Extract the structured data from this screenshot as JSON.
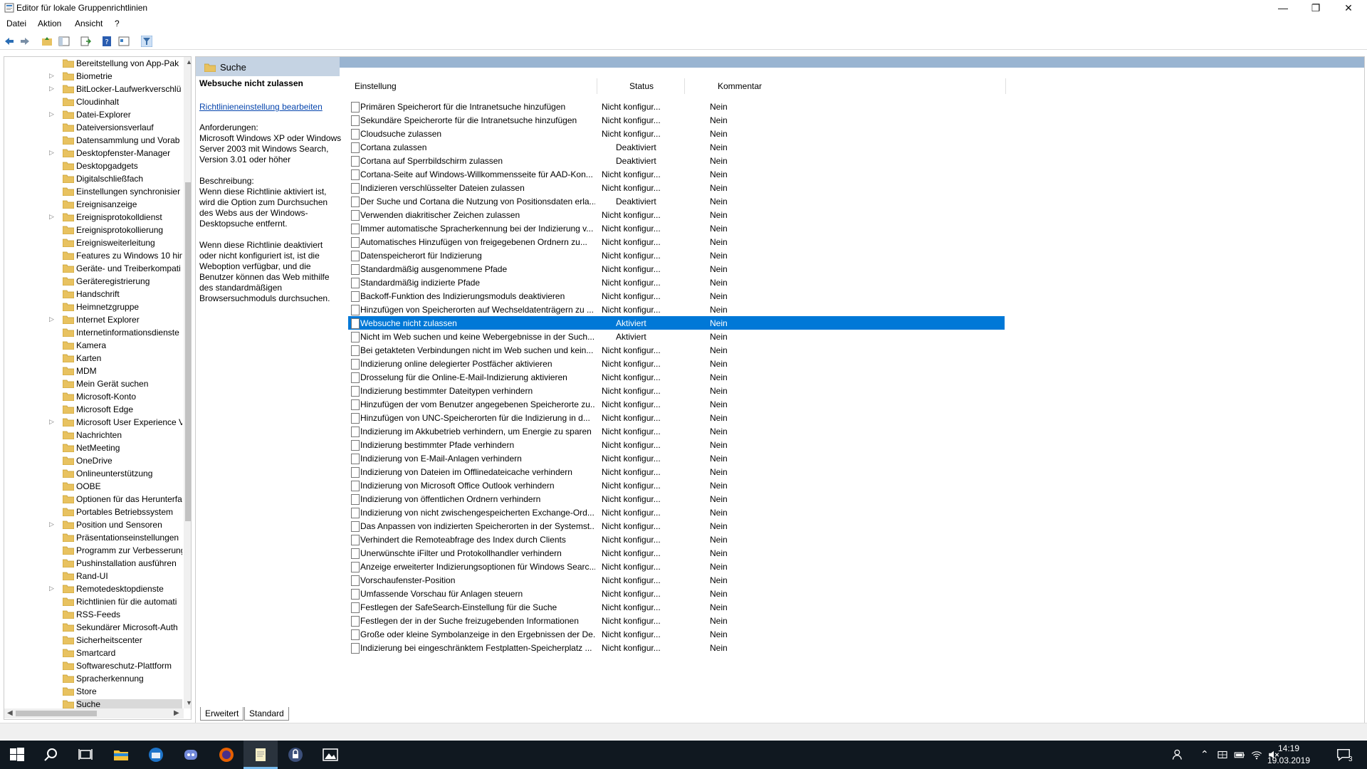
{
  "window": {
    "title": "Editor für lokale Gruppenrichtlinien"
  },
  "menu": [
    "Datei",
    "Aktion",
    "Ansicht",
    "?"
  ],
  "tree": {
    "items": [
      {
        "label": "Bereitstellung von App-Pak",
        "expandable": false
      },
      {
        "label": "Biometrie",
        "expandable": true
      },
      {
        "label": "BitLocker-Laufwerkverschlü",
        "expandable": true
      },
      {
        "label": "Cloudinhalt",
        "expandable": false
      },
      {
        "label": "Datei-Explorer",
        "expandable": true
      },
      {
        "label": "Dateiversionsverlauf",
        "expandable": false
      },
      {
        "label": "Datensammlung und Vorab",
        "expandable": false
      },
      {
        "label": "Desktopfenster-Manager",
        "expandable": true
      },
      {
        "label": "Desktopgadgets",
        "expandable": false
      },
      {
        "label": "Digitalschließfach",
        "expandable": false
      },
      {
        "label": "Einstellungen synchronisier",
        "expandable": false
      },
      {
        "label": "Ereignisanzeige",
        "expandable": false
      },
      {
        "label": "Ereignisprotokolldienst",
        "expandable": true
      },
      {
        "label": "Ereignisprotokollierung",
        "expandable": false
      },
      {
        "label": "Ereignisweiterleitung",
        "expandable": false
      },
      {
        "label": "Features zu Windows 10 hin",
        "expandable": false
      },
      {
        "label": "Geräte- und Treiberkompati",
        "expandable": false
      },
      {
        "label": "Geräteregistrierung",
        "expandable": false
      },
      {
        "label": "Handschrift",
        "expandable": false
      },
      {
        "label": "Heimnetzgruppe",
        "expandable": false
      },
      {
        "label": "Internet Explorer",
        "expandable": true
      },
      {
        "label": "Internetinformationsdienste",
        "expandable": false
      },
      {
        "label": "Kamera",
        "expandable": false
      },
      {
        "label": "Karten",
        "expandable": false
      },
      {
        "label": "MDM",
        "expandable": false
      },
      {
        "label": "Mein Gerät suchen",
        "expandable": false
      },
      {
        "label": "Microsoft-Konto",
        "expandable": false
      },
      {
        "label": "Microsoft Edge",
        "expandable": false
      },
      {
        "label": "Microsoft User Experience V",
        "expandable": true
      },
      {
        "label": "Nachrichten",
        "expandable": false
      },
      {
        "label": "NetMeeting",
        "expandable": false
      },
      {
        "label": "OneDrive",
        "expandable": false
      },
      {
        "label": "Onlineunterstützung",
        "expandable": false
      },
      {
        "label": "OOBE",
        "expandable": false
      },
      {
        "label": "Optionen für das Herunterfa",
        "expandable": false
      },
      {
        "label": "Portables Betriebssystem",
        "expandable": false
      },
      {
        "label": "Position und Sensoren",
        "expandable": true
      },
      {
        "label": "Präsentationseinstellungen",
        "expandable": false
      },
      {
        "label": "Programm zur Verbesserung",
        "expandable": false
      },
      {
        "label": "Pushinstallation ausführen",
        "expandable": false
      },
      {
        "label": "Rand-UI",
        "expandable": false
      },
      {
        "label": "Remotedesktopdienste",
        "expandable": true
      },
      {
        "label": "Richtlinien für die automati",
        "expandable": false
      },
      {
        "label": "RSS-Feeds",
        "expandable": false
      },
      {
        "label": "Sekundärer Microsoft-Auth",
        "expandable": false
      },
      {
        "label": "Sicherheitscenter",
        "expandable": false
      },
      {
        "label": "Smartcard",
        "expandable": false
      },
      {
        "label": "Softwareschutz-Plattform",
        "expandable": false
      },
      {
        "label": "Spracherkennung",
        "expandable": false
      },
      {
        "label": "Store",
        "expandable": false
      },
      {
        "label": "Suche",
        "expandable": false,
        "selected": true
      }
    ]
  },
  "main": {
    "title": "Suche",
    "description": {
      "title": "Websuche nicht zulassen",
      "link": "Richtlinieneinstellung bearbeiten",
      "requirements_label": "Anforderungen:",
      "requirements_text": "Microsoft Windows XP oder Windows Server 2003 mit Windows Search, Version 3.01 oder höher",
      "description_label": "Beschreibung:",
      "description_p1": "Wenn diese Richtlinie aktiviert ist, wird die Option zum Durchsuchen des Webs aus der Windows-Desktopsuche entfernt.",
      "description_p2": "Wenn diese Richtlinie deaktiviert oder nicht konfiguriert ist, ist die Weboption verfügbar, und die Benutzer können das Web mithilfe des standardmäßigen Browsersuchmoduls durchsuchen."
    },
    "columns": {
      "setting": "Einstellung",
      "status": "Status",
      "comment": "Kommentar"
    },
    "rows": [
      {
        "name": "Primären Speicherort für die Intranetsuche hinzufügen",
        "status": "Nicht konfigur...",
        "comment": "Nein"
      },
      {
        "name": "Sekundäre Speicherorte für die Intranetsuche hinzufügen",
        "status": "Nicht konfigur...",
        "comment": "Nein"
      },
      {
        "name": "Cloudsuche zulassen",
        "status": "Nicht konfigur...",
        "comment": "Nein"
      },
      {
        "name": "Cortana zulassen",
        "status": "Deaktiviert",
        "comment": "Nein"
      },
      {
        "name": "Cortana auf Sperrbildschirm zulassen",
        "status": "Deaktiviert",
        "comment": "Nein"
      },
      {
        "name": "Cortana-Seite auf Windows-Willkommensseite für AAD-Kon...",
        "status": "Nicht konfigur...",
        "comment": "Nein"
      },
      {
        "name": "Indizieren verschlüsselter Dateien zulassen",
        "status": "Nicht konfigur...",
        "comment": "Nein"
      },
      {
        "name": "Der Suche und Cortana die Nutzung von Positionsdaten erla...",
        "status": "Deaktiviert",
        "comment": "Nein"
      },
      {
        "name": "Verwenden diakritischer Zeichen zulassen",
        "status": "Nicht konfigur...",
        "comment": "Nein"
      },
      {
        "name": "Immer automatische Spracherkennung bei der Indizierung v...",
        "status": "Nicht konfigur...",
        "comment": "Nein"
      },
      {
        "name": "Automatisches Hinzufügen von freigegebenen Ordnern zu...",
        "status": "Nicht konfigur...",
        "comment": "Nein"
      },
      {
        "name": "Datenspeicherort für Indizierung",
        "status": "Nicht konfigur...",
        "comment": "Nein"
      },
      {
        "name": "Standardmäßig ausgenommene Pfade",
        "status": "Nicht konfigur...",
        "comment": "Nein"
      },
      {
        "name": "Standardmäßig indizierte Pfade",
        "status": "Nicht konfigur...",
        "comment": "Nein"
      },
      {
        "name": "Backoff-Funktion des Indizierungsmoduls deaktivieren",
        "status": "Nicht konfigur...",
        "comment": "Nein"
      },
      {
        "name": "Hinzufügen von Speicherorten auf Wechseldatenträgern zu ...",
        "status": "Nicht konfigur...",
        "comment": "Nein"
      },
      {
        "name": "Websuche nicht zulassen",
        "status": "Aktiviert",
        "comment": "Nein",
        "selected": true
      },
      {
        "name": "Nicht im Web suchen und keine Webergebnisse in der Such...",
        "status": "Aktiviert",
        "comment": "Nein"
      },
      {
        "name": "Bei getakteten Verbindungen nicht im Web suchen und kein...",
        "status": "Nicht konfigur...",
        "comment": "Nein"
      },
      {
        "name": "Indizierung online delegierter Postfächer aktivieren",
        "status": "Nicht konfigur...",
        "comment": "Nein"
      },
      {
        "name": "Drosselung für die Online-E-Mail-Indizierung aktivieren",
        "status": "Nicht konfigur...",
        "comment": "Nein"
      },
      {
        "name": "Indizierung bestimmter Dateitypen verhindern",
        "status": "Nicht konfigur...",
        "comment": "Nein"
      },
      {
        "name": "Hinzufügen der vom Benutzer angegebenen Speicherorte zu...",
        "status": "Nicht konfigur...",
        "comment": "Nein"
      },
      {
        "name": "Hinzufügen von UNC-Speicherorten für die Indizierung in d...",
        "status": "Nicht konfigur...",
        "comment": "Nein"
      },
      {
        "name": "Indizierung im Akkubetrieb verhindern, um Energie zu sparen",
        "status": "Nicht konfigur...",
        "comment": "Nein"
      },
      {
        "name": "Indizierung bestimmter Pfade verhindern",
        "status": "Nicht konfigur...",
        "comment": "Nein"
      },
      {
        "name": "Indizierung von E-Mail-Anlagen verhindern",
        "status": "Nicht konfigur...",
        "comment": "Nein"
      },
      {
        "name": "Indizierung von Dateien im Offlinedateicache verhindern",
        "status": "Nicht konfigur...",
        "comment": "Nein"
      },
      {
        "name": "Indizierung von Microsoft Office Outlook verhindern",
        "status": "Nicht konfigur...",
        "comment": "Nein"
      },
      {
        "name": "Indizierung von öffentlichen Ordnern verhindern",
        "status": "Nicht konfigur...",
        "comment": "Nein"
      },
      {
        "name": "Indizierung von nicht zwischengespeicherten Exchange-Ord...",
        "status": "Nicht konfigur...",
        "comment": "Nein"
      },
      {
        "name": "Das Anpassen von indizierten Speicherorten in der Systemst...",
        "status": "Nicht konfigur...",
        "comment": "Nein"
      },
      {
        "name": "Verhindert die Remoteabfrage des Index durch Clients",
        "status": "Nicht konfigur...",
        "comment": "Nein"
      },
      {
        "name": "Unerwünschte iFilter und Protokollhandler verhindern",
        "status": "Nicht konfigur...",
        "comment": "Nein"
      },
      {
        "name": "Anzeige erweiterter Indizierungsoptionen für Windows Searc...",
        "status": "Nicht konfigur...",
        "comment": "Nein"
      },
      {
        "name": "Vorschaufenster-Position",
        "status": "Nicht konfigur...",
        "comment": "Nein"
      },
      {
        "name": "Umfassende Vorschau für Anlagen steuern",
        "status": "Nicht konfigur...",
        "comment": "Nein"
      },
      {
        "name": "Festlegen der SafeSearch-Einstellung für die Suche",
        "status": "Nicht konfigur...",
        "comment": "Nein"
      },
      {
        "name": "Festlegen der in der Suche freizugebenden Informationen",
        "status": "Nicht konfigur...",
        "comment": "Nein"
      },
      {
        "name": "Große oder kleine Symbolanzeige in den Ergebnissen der De...",
        "status": "Nicht konfigur...",
        "comment": "Nein"
      },
      {
        "name": "Indizierung bei eingeschränktem Festplatten-Speicherplatz ...",
        "status": "Nicht konfigur...",
        "comment": "Nein"
      }
    ],
    "tabs": [
      "Erweitert",
      "Standard"
    ]
  },
  "taskbar": {
    "time": "14:19",
    "date": "19.03.2019",
    "notifications": "3"
  },
  "colors": {
    "selection": "#0078d7",
    "header_light": "#c5d3e3",
    "header_dark": "#99b4d1",
    "link": "#0645ad",
    "taskbar": "#101820"
  }
}
